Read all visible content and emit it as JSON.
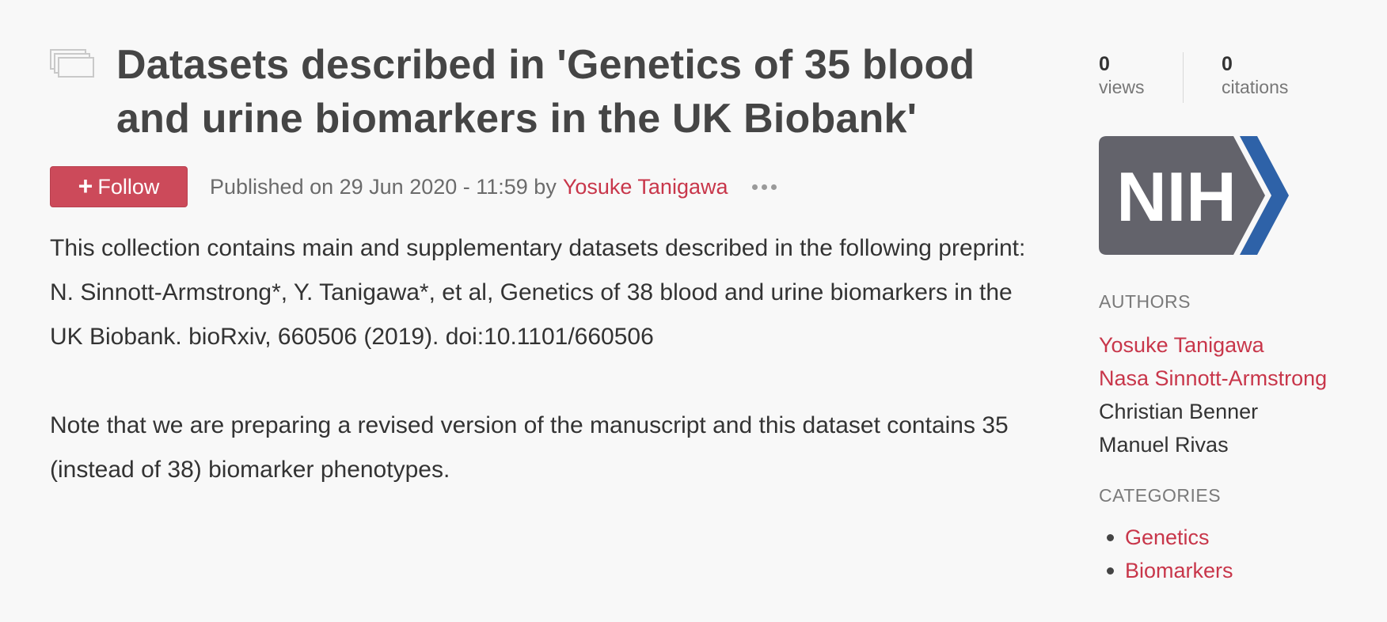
{
  "title": "Datasets described in 'Genetics of 35 blood and urine biomarkers in the UK Biobank'",
  "follow_button": {
    "icon": "plus-icon",
    "label": "Follow"
  },
  "published": {
    "prefix": "Published on 29 Jun 2020 - 11:59 by",
    "author": "Yosuke Tanigawa"
  },
  "description": {
    "paragraph1": "This collection contains main and supplementary datasets described in the following preprint:",
    "paragraph2": "N. Sinnott-Armstrong*, Y. Tanigawa*, et al, Genetics of 38 blood and urine biomarkers in the UK Biobank. bioRxiv, 660506 (2019). doi:10.1101/660506",
    "paragraph3": "Note that we are preparing a revised version of the manuscript and this dataset contains 35 (instead of 38) biomarker phenotypes."
  },
  "stats": {
    "views_count": "0",
    "views_label": "views",
    "citations_count": "0",
    "citations_label": "citations"
  },
  "logo": {
    "text": "NIH",
    "colors": {
      "box": "#63636b",
      "chevron": "#2e62a8"
    }
  },
  "authors": {
    "title": "AUTHORS",
    "items": [
      {
        "name": "Yosuke Tanigawa",
        "linked": true
      },
      {
        "name": "Nasa Sinnott-Armstrong",
        "linked": true
      },
      {
        "name": "Christian Benner",
        "linked": false
      },
      {
        "name": "Manuel Rivas",
        "linked": false
      }
    ]
  },
  "categories": {
    "title": "CATEGORIES",
    "items": [
      "Genetics",
      "Biomarkers"
    ]
  },
  "colors": {
    "accent": "#cc4a5a",
    "link": "#c8364a",
    "background": "#f8f8f8"
  }
}
